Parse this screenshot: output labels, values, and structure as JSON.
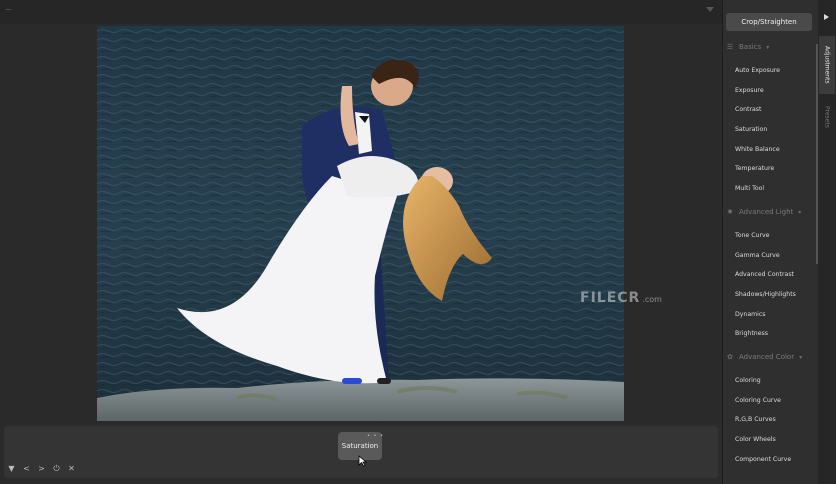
{
  "editor": {
    "top_bar_label": "~",
    "watermark": {
      "main": "FILECR",
      "sub": ".com"
    }
  },
  "bottom_bar": {
    "tool_label": "Saturation",
    "tool_badge": "• • •",
    "controls": [
      "▼",
      "<",
      ">",
      "⏻",
      "✕"
    ]
  },
  "panel": {
    "primary_button": "Crop/Straighten",
    "sections": [
      {
        "title": "Basics",
        "icon": "sliders-icon",
        "items": [
          "Auto Exposure",
          "Exposure",
          "Contrast",
          "Saturation",
          "White Balance",
          "Temperature",
          "Multi Tool"
        ]
      },
      {
        "title": "Advanced Light",
        "icon": "sun-icon",
        "items": [
          "Tone Curve",
          "Gamma Curve",
          "Advanced Contrast",
          "Shadows/Highlights",
          "Dynamics",
          "Brightness"
        ]
      },
      {
        "title": "Advanced Color",
        "icon": "palette-icon",
        "items": [
          "Coloring",
          "Coloring Curve",
          "R,G,B Curves",
          "Color Wheels",
          "Component Curve"
        ]
      }
    ],
    "tabs": [
      "Adjustments",
      "Presets"
    ]
  }
}
